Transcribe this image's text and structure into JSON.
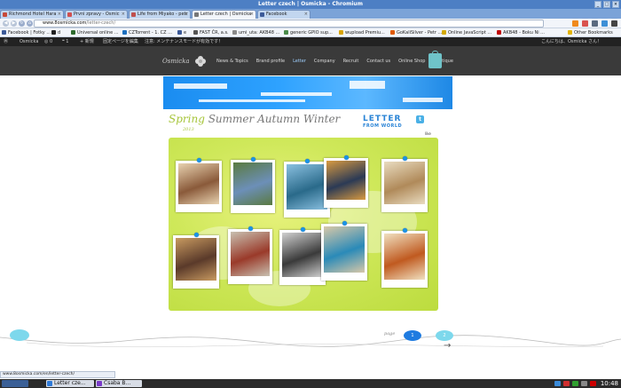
{
  "window": {
    "title": "Letter czech | Osmicka - Chromium",
    "controls": [
      "_",
      "□",
      "×"
    ]
  },
  "tabs": [
    {
      "label": "Richmond Hotel Hara",
      "color": "#c74a3a",
      "active": false
    },
    {
      "label": "Prvni zpravy - Osmic",
      "color": "#d05050",
      "active": false
    },
    {
      "label": "Life from Miyako - petr",
      "color": "#c0504d",
      "active": false
    },
    {
      "label": "Letter czech | Osmicka",
      "color": "#777777",
      "active": true
    },
    {
      "label": "Facebook",
      "color": "#3b5998",
      "active": false
    }
  ],
  "toolbar": {
    "url_host": "www.8osmicka.com",
    "url_path": "/letter-czech/",
    "icons": [
      "back-icon",
      "forward-icon",
      "reload-icon",
      "home-icon"
    ]
  },
  "bookmarks": [
    {
      "label": "Facebook | Fotky ...",
      "color": "#3b5998"
    },
    {
      "label": "d",
      "color": "#222222"
    },
    {
      "label": "Universal online ...",
      "color": "#2d6a2d"
    },
    {
      "label": "CZTorrent - 1. CZ ...",
      "color": "#1c6fbf"
    },
    {
      "label": "e",
      "color": "#3b5998"
    },
    {
      "label": "FAST ČR, a.s.",
      "color": "#555555"
    },
    {
      "label": "umi_uta: AKB48 ...",
      "color": "#8a8a8a"
    },
    {
      "label": "generic GPIO sup...",
      "color": "#4a8a4a"
    },
    {
      "label": "wupload Premiu...",
      "color": "#d9a400"
    },
    {
      "label": "GoKaliSilver - Petr ...",
      "color": "#e05a00"
    },
    {
      "label": "Online JavaScript ...",
      "color": "#d4aa00"
    },
    {
      "label": "AKB48 - Boku Ni ...",
      "color": "#c00000"
    },
    {
      "label": "Other Bookmarks",
      "color": "#e2b300"
    }
  ],
  "adminbar": {
    "site": "Osmicka",
    "comments": "0",
    "updates": "1",
    "new": "+ 新規",
    "edit": "固定ページを編集",
    "maint": "注意: メンテナンスモードが有効です！",
    "greeting": "こんにちは、Osmicka さん！"
  },
  "header": {
    "logo": "Osmicka",
    "nav": [
      "News & Topics",
      "Brand profile",
      "Letter",
      "Company",
      "Recruit",
      "Contact us",
      "Online Shop",
      "Boutique"
    ],
    "current": "Letter"
  },
  "content": {
    "seasons": {
      "spring": "Spring",
      "rest": " Summer Autumn Winter"
    },
    "year": "2013",
    "lfw_line1": "LETTER",
    "lfw_line2": "FROM WORLD",
    "like": "like"
  },
  "photos": [
    {
      "color": "#8a5a3a",
      "accent": "#e8d2b0"
    },
    {
      "color": "#6c8fb8",
      "accent": "#5a7a40"
    },
    {
      "color": "#2a6a8a",
      "accent": "#8ac0e0"
    },
    {
      "color": "#2b3a55",
      "accent": "#d89a40"
    },
    {
      "color": "#b08a5a",
      "accent": "#e9dcc0"
    },
    {
      "color": "#5a3a2a",
      "accent": "#c89a60"
    },
    {
      "color": "#9a3a2a",
      "accent": "#c8c0b0"
    },
    {
      "color": "#3a3a3a",
      "accent": "#d0d0d0"
    },
    {
      "color": "#2a8ab8",
      "accent": "#d8c8a8"
    },
    {
      "color": "#c05a20",
      "accent": "#f0e0c0"
    }
  ],
  "timeline": {
    "page_word": "page",
    "page1": "1",
    "page2": "2",
    "next": "→"
  },
  "status": {
    "url": "www.8osmicka.com/en/letter-czech/"
  },
  "taskbar": {
    "tasks": [
      {
        "label": "Letter cze...",
        "color": "#2f7ad8"
      },
      {
        "label": "Csaba B...",
        "color": "#7a3ac8"
      }
    ],
    "clock": "10:48",
    "tray": [
      "#3a8ad8",
      "#d03030",
      "#30a030",
      "#888888",
      "#cc0000"
    ]
  }
}
